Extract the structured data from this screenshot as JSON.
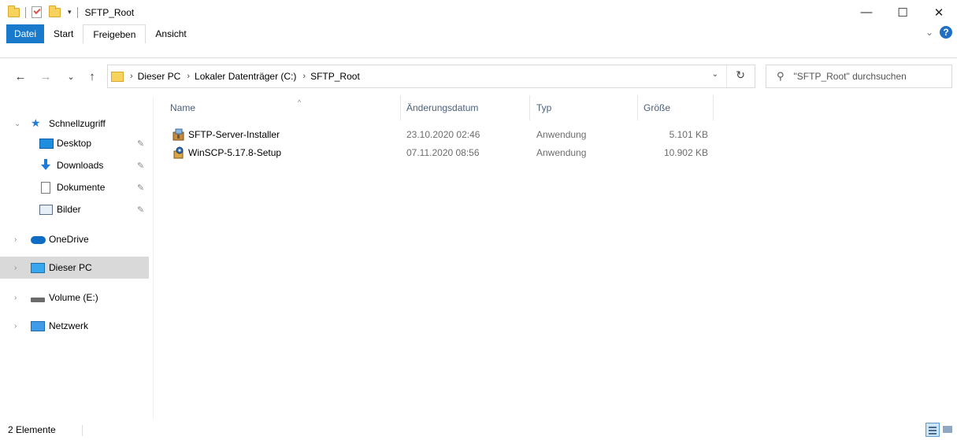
{
  "window": {
    "title": "SFTP_Root",
    "controls": {
      "minimize": "—",
      "maximize": "☐",
      "close": "✕"
    }
  },
  "ribbon": {
    "tabs": [
      {
        "label": "Datei"
      },
      {
        "label": "Start"
      },
      {
        "label": "Freigeben"
      },
      {
        "label": "Ansicht"
      }
    ],
    "expand_icon": "chevron-down-icon",
    "help_icon": "?"
  },
  "navigation": {
    "back": "←",
    "forward": "→",
    "recent": "⌄",
    "up": "↑",
    "breadcrumb": [
      "Dieser PC",
      "Lokaler Datenträger (C:)",
      "SFTP_Root"
    ],
    "separator": "›",
    "dropdown": "⌄",
    "refresh": "↻"
  },
  "search": {
    "icon": "⚲",
    "placeholder": "\"SFTP_Root\" durchsuchen"
  },
  "sidebar": {
    "quick_access": {
      "label": "Schnellzugriff",
      "items": [
        {
          "label": "Desktop",
          "icon": "desktop-icon"
        },
        {
          "label": "Downloads",
          "icon": "downloads-icon"
        },
        {
          "label": "Dokumente",
          "icon": "documents-icon"
        },
        {
          "label": "Bilder",
          "icon": "pictures-icon"
        }
      ]
    },
    "roots": [
      {
        "label": "OneDrive",
        "icon": "onedrive-icon"
      },
      {
        "label": "Dieser PC",
        "icon": "this-pc-icon",
        "selected": true
      },
      {
        "label": "Volume (E:)",
        "icon": "drive-icon"
      },
      {
        "label": "Netzwerk",
        "icon": "network-icon"
      }
    ]
  },
  "file_list": {
    "columns": [
      "Name",
      "Änderungsdatum",
      "Typ",
      "Größe"
    ],
    "sort_indicator": "^",
    "rows": [
      {
        "name": "SFTP-Server-Installer",
        "date": "23.10.2020 02:46",
        "type": "Anwendung",
        "size": "5.101 KB",
        "icon": "installer-icon"
      },
      {
        "name": "WinSCP-5.17.8-Setup",
        "date": "07.11.2020 08:56",
        "type": "Anwendung",
        "size": "10.902 KB",
        "icon": "setup-icon"
      }
    ]
  },
  "status": {
    "count": "2 Elemente"
  },
  "colors": {
    "accent": "#1979ca",
    "selection": "#d9d9d9",
    "header_text": "#4c607a"
  }
}
